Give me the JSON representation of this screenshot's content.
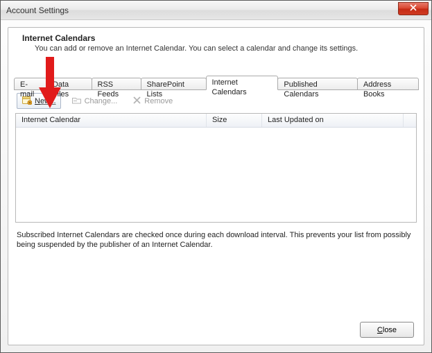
{
  "window": {
    "title": "Account Settings"
  },
  "header": {
    "title": "Internet Calendars",
    "desc": "You can add or remove an Internet Calendar. You can select a calendar and change its settings."
  },
  "tabs": [
    {
      "label": "E-mail"
    },
    {
      "label": "Data Files"
    },
    {
      "label": "RSS Feeds"
    },
    {
      "label": "SharePoint Lists"
    },
    {
      "label": "Internet Calendars"
    },
    {
      "label": "Published Calendars"
    },
    {
      "label": "Address Books"
    }
  ],
  "active_tab_index": 4,
  "toolbar": {
    "new_label": "New...",
    "change_label": "Change...",
    "remove_label": "Remove"
  },
  "columns": {
    "c1": "Internet Calendar",
    "c2": "Size",
    "c3": "Last Updated on"
  },
  "notes": "Subscribed Internet Calendars are checked once during each download interval. This prevents your list from possibly being suspended by the publisher of an Internet Calendar.",
  "footer": {
    "close_label": "Close"
  },
  "icons": {
    "close_x": "x",
    "new": "calendar-new-icon",
    "change": "folder-change-icon",
    "remove": "remove-x-icon"
  },
  "colors": {
    "arrow": "#e11b1b",
    "close_btn": "#c42a14"
  }
}
